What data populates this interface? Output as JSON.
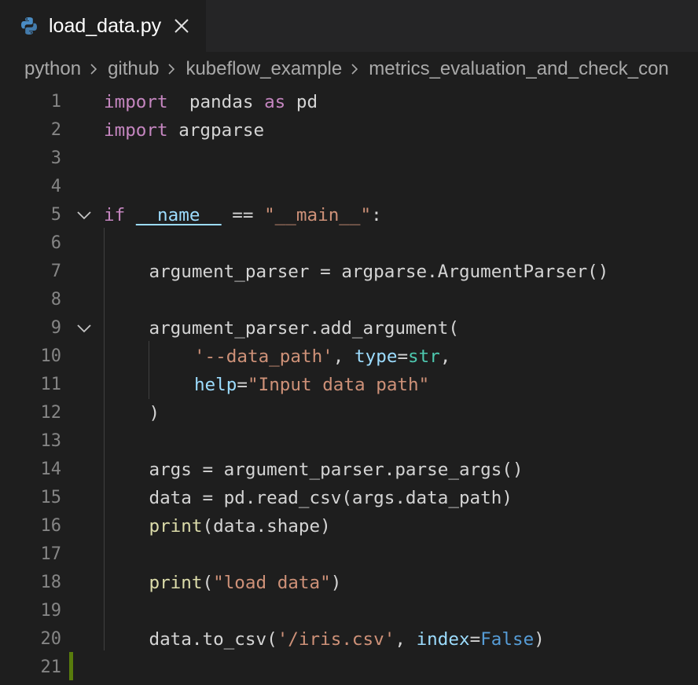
{
  "tab": {
    "filename": "load_data.py",
    "icon": "python-icon"
  },
  "breadcrumb": [
    "python",
    "github",
    "kubeflow_example",
    "metrics_evaluation_and_check_con"
  ],
  "editor": {
    "lines": [
      {
        "n": "1",
        "fold": false,
        "indent": 0,
        "tokens": [
          [
            "kw-ctrl",
            "import"
          ],
          [
            "",
            "  "
          ],
          [
            "",
            "pandas"
          ],
          [
            "",
            " "
          ],
          [
            "kw-ctrl",
            "as"
          ],
          [
            "",
            " pd"
          ]
        ]
      },
      {
        "n": "2",
        "fold": false,
        "indent": 0,
        "tokens": [
          [
            "kw-ctrl",
            "import"
          ],
          [
            "",
            " argparse"
          ]
        ]
      },
      {
        "n": "3",
        "fold": false,
        "indent": 0,
        "tokens": []
      },
      {
        "n": "4",
        "fold": false,
        "indent": 0,
        "tokens": []
      },
      {
        "n": "5",
        "fold": true,
        "indent": 0,
        "tokens": [
          [
            "kw-ctrl",
            "if"
          ],
          [
            "",
            " "
          ],
          [
            "name-dunder",
            "__name__"
          ],
          [
            "",
            " == "
          ],
          [
            "str",
            "\"__main__\""
          ],
          [
            "",
            ":"
          ]
        ]
      },
      {
        "n": "6",
        "fold": false,
        "indent": 0,
        "tokens": []
      },
      {
        "n": "7",
        "fold": false,
        "indent": 4,
        "tokens": [
          [
            "",
            "argument_parser = argparse.ArgumentParser()"
          ]
        ]
      },
      {
        "n": "8",
        "fold": false,
        "indent": 0,
        "tokens": []
      },
      {
        "n": "9",
        "fold": true,
        "indent": 4,
        "tokens": [
          [
            "",
            "argument_parser.add_argument("
          ]
        ]
      },
      {
        "n": "10",
        "fold": false,
        "indent": 8,
        "tokens": [
          [
            "str",
            "'--data_path'"
          ],
          [
            "",
            ", "
          ],
          [
            "var",
            "type"
          ],
          [
            "",
            "="
          ],
          [
            "type",
            "str"
          ],
          [
            "",
            ","
          ]
        ]
      },
      {
        "n": "11",
        "fold": false,
        "indent": 8,
        "tokens": [
          [
            "var",
            "help"
          ],
          [
            "",
            "="
          ],
          [
            "str",
            "\"Input data path\""
          ]
        ]
      },
      {
        "n": "12",
        "fold": false,
        "indent": 4,
        "tokens": [
          [
            "",
            ")"
          ]
        ]
      },
      {
        "n": "13",
        "fold": false,
        "indent": 0,
        "tokens": []
      },
      {
        "n": "14",
        "fold": false,
        "indent": 4,
        "tokens": [
          [
            "",
            "args = argument_parser.parse_args()"
          ]
        ]
      },
      {
        "n": "15",
        "fold": false,
        "indent": 4,
        "tokens": [
          [
            "",
            "data = pd.read_csv(args.data_path)"
          ]
        ]
      },
      {
        "n": "16",
        "fold": false,
        "indent": 4,
        "tokens": [
          [
            "fn",
            "print"
          ],
          [
            "",
            "(data.shape)"
          ]
        ]
      },
      {
        "n": "17",
        "fold": false,
        "indent": 0,
        "tokens": []
      },
      {
        "n": "18",
        "fold": false,
        "indent": 4,
        "tokens": [
          [
            "fn",
            "print"
          ],
          [
            "",
            "("
          ],
          [
            "str",
            "\"load data\""
          ],
          [
            "",
            ")"
          ]
        ]
      },
      {
        "n": "19",
        "fold": false,
        "indent": 0,
        "tokens": []
      },
      {
        "n": "20",
        "fold": false,
        "indent": 4,
        "tokens": [
          [
            "",
            "data.to_csv("
          ],
          [
            "str",
            "'/iris.csv'"
          ],
          [
            "",
            ", "
          ],
          [
            "var",
            "index"
          ],
          [
            "",
            "="
          ],
          [
            "kw",
            "False"
          ],
          [
            "",
            ")"
          ]
        ]
      },
      {
        "n": "21",
        "fold": false,
        "indent": 0,
        "tokens": []
      }
    ]
  },
  "colors": {
    "background": "#1e1e1e",
    "tabbar": "#252526",
    "keyword_control": "#c586c0",
    "keyword": "#569cd6",
    "variable": "#9cdcfe",
    "string": "#ce9178",
    "function": "#dcdcaa",
    "type": "#4ec9b0",
    "line_number": "#858585",
    "added_line_gutter": "#587c0c"
  }
}
